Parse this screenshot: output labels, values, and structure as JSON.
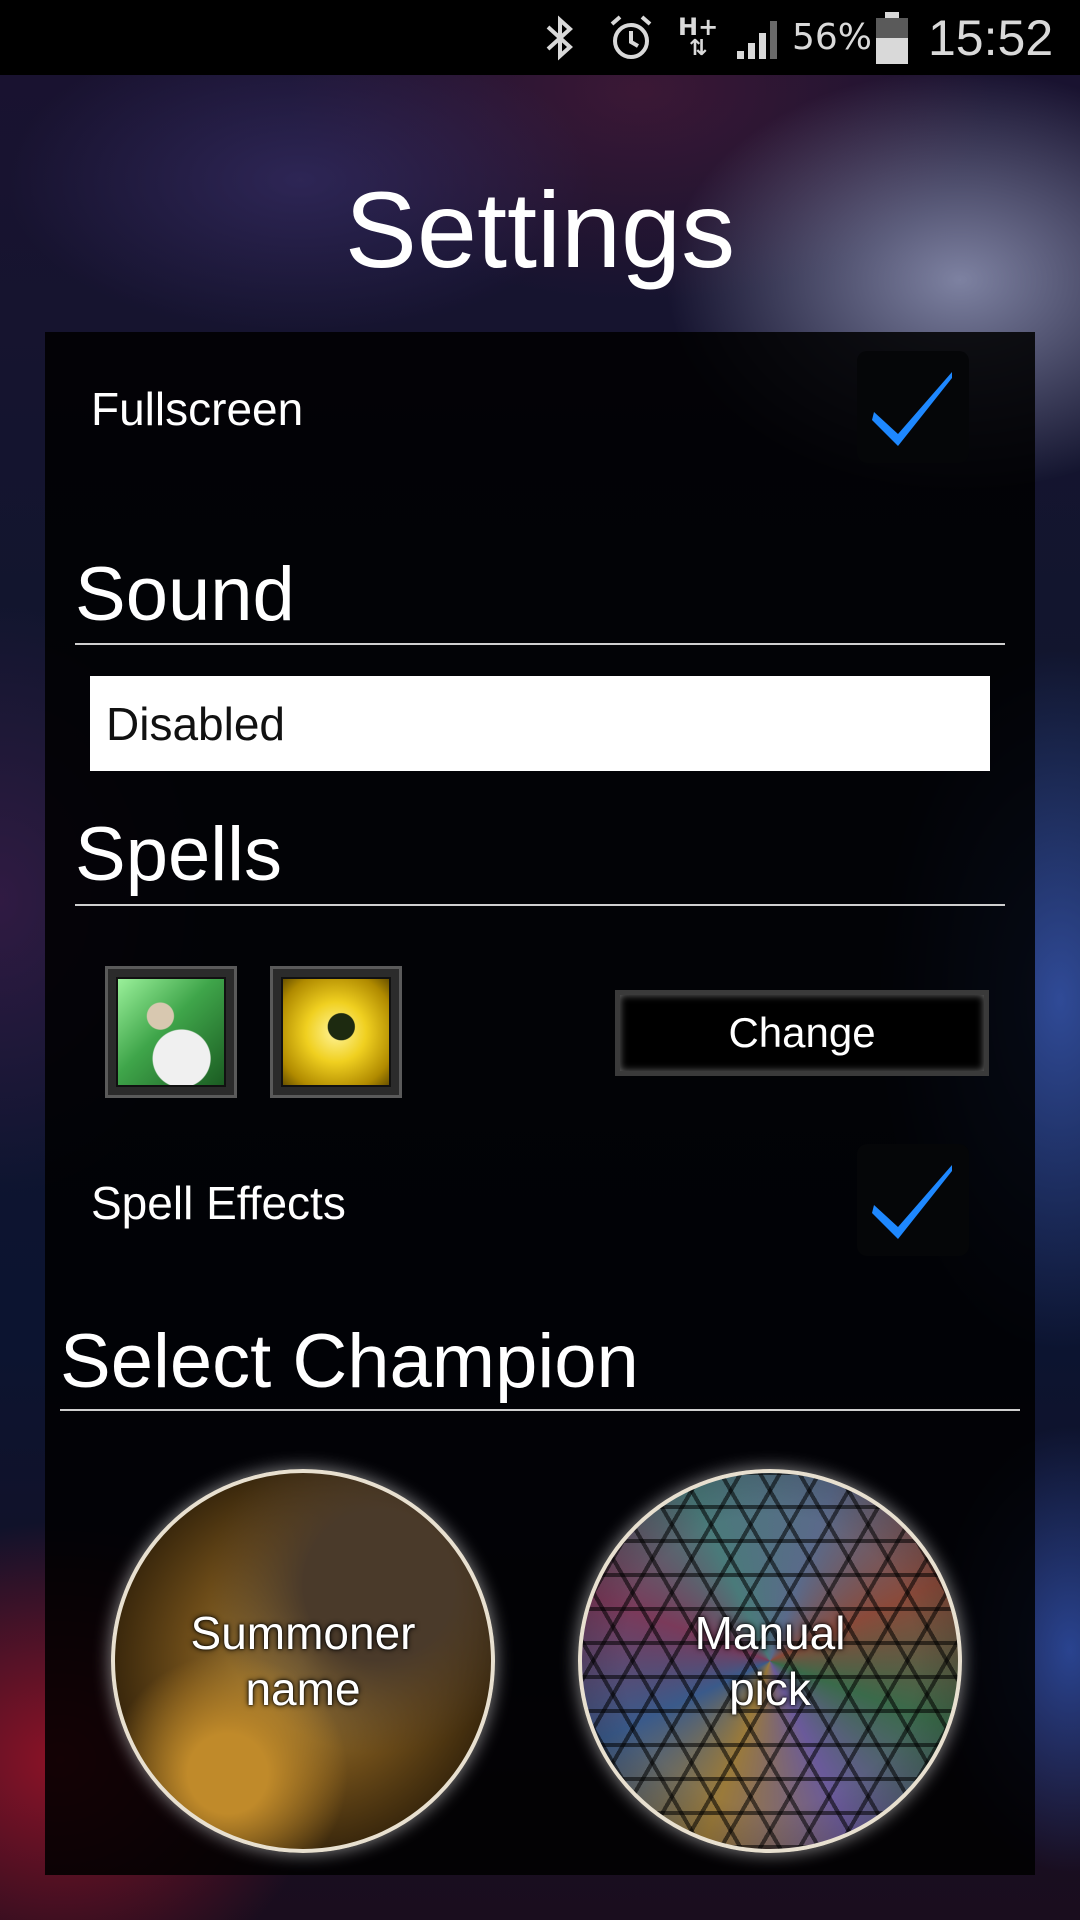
{
  "status_bar": {
    "network": "H+",
    "battery_percent": "56%",
    "time": "15:52",
    "icons": [
      "bluetooth-icon",
      "alarm-icon",
      "network-hplus-icon",
      "signal-icon",
      "battery-icon"
    ]
  },
  "page": {
    "title": "Settings"
  },
  "settings": {
    "fullscreen": {
      "label": "Fullscreen",
      "checked": true
    },
    "sound": {
      "heading": "Sound",
      "selected": "Disabled"
    },
    "spells": {
      "heading": "Spells",
      "slots": [
        "heal-spell-icon",
        "flash-spell-icon"
      ],
      "change_label": "Change"
    },
    "spell_effects": {
      "label": "Spell Effects",
      "checked": true
    },
    "select_champion": {
      "heading": "Select Champion",
      "options": [
        {
          "label_line1": "Summoner",
          "label_line2": "name"
        },
        {
          "label_line1": "Manual",
          "label_line2": "pick"
        }
      ]
    }
  },
  "colors": {
    "accent_check": "#1e88ff",
    "panel_bg": "#000000",
    "text": "#ffffff"
  }
}
